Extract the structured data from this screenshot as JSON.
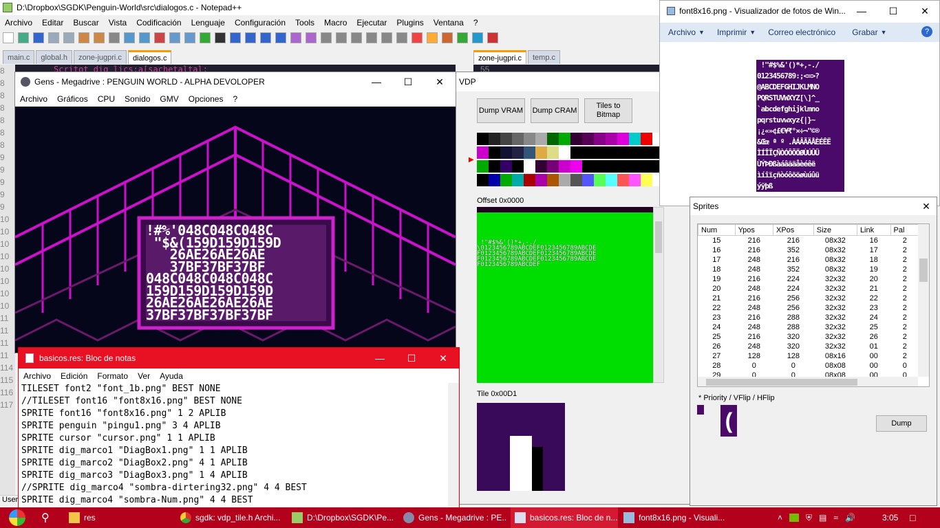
{
  "npp": {
    "title": "D:\\Dropbox\\SGDK\\Penguin-World\\src\\dialogos.c - Notepad++",
    "menu": [
      "Archivo",
      "Editar",
      "Buscar",
      "Vista",
      "Codificación",
      "Lenguaje",
      "Configuración",
      "Tools",
      "Macro",
      "Ejecutar",
      "Plugins",
      "Ventana",
      "?"
    ],
    "tabs": [
      "main.c",
      "global.h",
      "zone-jugpri.c",
      "dialogos.c"
    ],
    "tabs2": [
      "zone-jugpri.c",
      "temp.c"
    ],
    "line_right": "55",
    "code_top": "Scritot dig lics:a[sachetaltal;",
    "gutter": [
      "8",
      "8",
      "8",
      "8",
      "8",
      "8",
      "8",
      "9",
      "9",
      "9",
      "9",
      "9",
      "10",
      "10",
      "10",
      "10",
      "10",
      "10",
      "10",
      "10",
      "11",
      "11",
      "11",
      "11",
      "114",
      "115",
      "116",
      "117"
    ],
    "status_left": "User"
  },
  "gens": {
    "title": "Gens - Megadrive : PENGUIN WORLD - ALPHA DEVOLOPER",
    "menu": [
      "Archivo",
      "Gráficos",
      "CPU",
      "Sonido",
      "GMV",
      "Opciones",
      "?"
    ],
    "dialog_lines": [
      "!#%'048C048C048C",
      " \"$&(159D159D159D",
      "   26AE26AE26AE",
      "   37BF37BF37BF",
      "048C048C048C048C",
      "159D159D159D159D",
      "26AE26AE26AE26AE",
      "37BF37BF37BF37BF"
    ]
  },
  "vdp": {
    "title": "VDP",
    "dump_vram": "Dump VRAM",
    "dump_cram": "Dump CRAM",
    "tiles_bitmap": "Tiles to Bitmap",
    "offset": "Offset 0x0000",
    "tile": "Tile 0x00D1",
    "vram_text": [
      " !\"#$%&'()*+,-./",
      "\\0123456789ABCDEF0123456789ABCDE",
      "F0123456789ABCDEF0123456789ABCDE",
      "F0123456789ABCDEF0123456789ABCDE",
      "F0123456789ABCDEF"
    ],
    "palette": [
      [
        "#000000",
        "#222222",
        "#444444",
        "#666666",
        "#888888",
        "#aaaaaa",
        "#006600",
        "#00aa00",
        "#330033",
        "#550055",
        "#880088",
        "#aa00aa",
        "#dd00dd",
        "#00cccc",
        "#ee0000",
        "#ffffff"
      ],
      [
        "#cc00cc",
        "#000000",
        "#111133",
        "#222244",
        "#335577",
        "#ddaa44",
        "#dddd88",
        "#ffffff",
        "#000000",
        "#000000",
        "#000000",
        "#000000",
        "#000000",
        "#000000",
        "#000000",
        "#000000"
      ],
      [
        "#00aa00",
        "#000000",
        "#330066",
        "#000000",
        "#ffffff",
        "#330033",
        "#770077",
        "#cc00cc",
        "#ee00ee",
        "#000000",
        "#000000",
        "#000000",
        "#000000",
        "#000000",
        "#000000",
        "#000000"
      ],
      [
        "#000000",
        "#0000aa",
        "#00aa00",
        "#00aaaa",
        "#aa0000",
        "#aa00aa",
        "#aa5500",
        "#aaaaaa",
        "#555555",
        "#5555ff",
        "#55ff55",
        "#55ffff",
        "#ff5555",
        "#ff55ff",
        "#ffff55",
        "#ffffff"
      ]
    ]
  },
  "photos": {
    "title": "font8x16.png - Visualizador de fotos de Win...",
    "menu": [
      "Archivo",
      "Imprimir",
      "Correo electrónico",
      "Grabar"
    ],
    "font_lines": [
      " !\"#$%&'()*+,-./",
      "0123456789:;<=>?",
      "@ABCDEFGHIJKLMNO",
      "PQRSTUVWXYZ[\\]^_",
      "`abcdefghijklmno",
      "pqrstuvwxyz{|}~ ",
      "¡¿«»¢£€¥₹°×÷¬\"©®",
      "&Œœ ª º .ÀÁÂÃÄÅÈÉÊË",
      "ÌÍÎÏÇÑÒÓÔÕÖØÙÚÛÜ",
      "ÙÝÞÐßàáâãäåèéêë",
      "ìíîïçñòóôõöøùúûü",
      "ýÿþß"
    ]
  },
  "sprites": {
    "title": "Sprites",
    "headers": [
      "Num",
      "Ypos",
      "XPos",
      "Size",
      "Link",
      "Pal"
    ],
    "rows": [
      [
        "15",
        "216",
        "216",
        "08x32",
        "16",
        "2"
      ],
      [
        "16",
        "216",
        "352",
        "08x32",
        "17",
        "2"
      ],
      [
        "17",
        "248",
        "216",
        "08x32",
        "18",
        "2"
      ],
      [
        "18",
        "248",
        "352",
        "08x32",
        "19",
        "2"
      ],
      [
        "19",
        "216",
        "224",
        "32x32",
        "20",
        "2"
      ],
      [
        "20",
        "248",
        "224",
        "32x32",
        "21",
        "2"
      ],
      [
        "21",
        "216",
        "256",
        "32x32",
        "22",
        "2"
      ],
      [
        "22",
        "248",
        "256",
        "32x32",
        "23",
        "2"
      ],
      [
        "23",
        "216",
        "288",
        "32x32",
        "24",
        "2"
      ],
      [
        "24",
        "248",
        "288",
        "32x32",
        "25",
        "2"
      ],
      [
        "25",
        "216",
        "320",
        "32x32",
        "26",
        "2"
      ],
      [
        "26",
        "248",
        "320",
        "32x32",
        "01",
        "2"
      ],
      [
        "27",
        "128",
        "128",
        "08x16",
        "00",
        "2"
      ],
      [
        "28",
        "0",
        "0",
        "08x08",
        "00",
        "0"
      ],
      [
        "29",
        "0",
        "0",
        "08x08",
        "00",
        "0"
      ]
    ],
    "note": "* Priority / VFlip / HFlip",
    "dump": "Dump"
  },
  "notepad": {
    "title": "basicos.res: Bloc de notas",
    "menu": [
      "Archivo",
      "Edición",
      "Formato",
      "Ver",
      "Ayuda"
    ],
    "lines": [
      "TILESET font2 \"font_1b.png\" BEST NONE",
      "//TILESET font16 \"font8x16.png\" BEST NONE",
      "SPRITE font16 \"font8x16.png\" 1 2 APLIB",
      "SPRITE penguin \"pingu1.png\" 3 4 APLIB",
      "SPRITE cursor \"cursor.png\" 1 1 APLIB",
      "SPRITE dig_marco1 \"DiagBox1.png\" 1 1 APLIB",
      "SPRITE dig_marco2 \"DiagBox2.png\" 4 1 APLIB",
      "SPRITE dig_marco3 \"DiagBox3.png\" 1 4 APLIB",
      "//SPRITE dig_marco4 \"sombra-dirtering32.png\" 4 4 BEST",
      "SPRITE dig_marco4 \"sombra-Num.png\" 4 4 BEST"
    ]
  },
  "taskbar": {
    "items": [
      "res",
      "sgdk: vdp_tile.h Archi...",
      "D:\\Dropbox\\SGDK\\Pe...",
      "Gens - Megadrive : PE...",
      "basicos.res: Bloc de n...",
      "font8x16.png - Visuali..."
    ],
    "time": "3:05"
  }
}
